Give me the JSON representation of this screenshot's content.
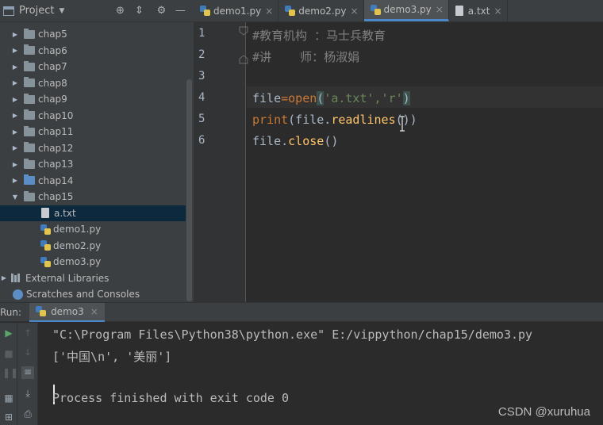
{
  "project": {
    "title": "Project",
    "dropdown_icon": "caret-down",
    "header_buttons": [
      "locate-icon",
      "collapse-icon",
      "gear-icon",
      "minimize-icon"
    ],
    "tree": [
      {
        "label": "chap5",
        "type": "folder",
        "expanded": false
      },
      {
        "label": "chap6",
        "type": "folder",
        "expanded": false
      },
      {
        "label": "chap7",
        "type": "folder",
        "expanded": false
      },
      {
        "label": "chap8",
        "type": "folder",
        "expanded": false
      },
      {
        "label": "chap9",
        "type": "folder",
        "expanded": false
      },
      {
        "label": "chap10",
        "type": "folder",
        "expanded": false
      },
      {
        "label": "chap11",
        "type": "folder",
        "expanded": false
      },
      {
        "label": "chap12",
        "type": "folder",
        "expanded": false
      },
      {
        "label": "chap13",
        "type": "folder",
        "expanded": false
      },
      {
        "label": "chap14",
        "type": "folder-blue",
        "expanded": false
      },
      {
        "label": "chap15",
        "type": "folder",
        "expanded": true
      },
      {
        "label": "a.txt",
        "type": "txt",
        "selected": true
      },
      {
        "label": "demo1.py",
        "type": "py"
      },
      {
        "label": "demo2.py",
        "type": "py"
      },
      {
        "label": "demo3.py",
        "type": "py"
      },
      {
        "label": "External Libraries",
        "type": "lib"
      },
      {
        "label": "Scratches and Consoles",
        "type": "scratch"
      }
    ]
  },
  "tabs": [
    {
      "label": "demo1.py",
      "type": "py",
      "active": false
    },
    {
      "label": "demo2.py",
      "type": "py",
      "active": false
    },
    {
      "label": "demo3.py",
      "type": "py",
      "active": true
    },
    {
      "label": "a.txt",
      "type": "txt",
      "active": false
    }
  ],
  "editor": {
    "line_numbers": [
      "1",
      "2",
      "3",
      "4",
      "5",
      "6"
    ],
    "lines": {
      "l1": "#教育机构 ：马士兵教育",
      "l2": "#讲    师：杨淑娟",
      "l4_var": "file",
      "l4_eq": "=",
      "l4_func": "open",
      "l4_open": "(",
      "l4_args": "'a.txt','r'",
      "l4_close": ")",
      "l5_print": "print",
      "l5_rest_a": "(file.",
      "l5_method": "readlines",
      "l5_rest_b": "())",
      "l6_a": "file.",
      "l6_method": "close",
      "l6_b": "()"
    }
  },
  "run": {
    "label": "Run:",
    "tab_label": "demo3",
    "console": [
      "\"C:\\Program Files\\Python38\\python.exe\" E:/vippython/chap15/demo3.py",
      "['中国\\n', '美丽']",
      "",
      "Process finished with exit code 0"
    ]
  },
  "watermark": "CSDN @xuruhua"
}
